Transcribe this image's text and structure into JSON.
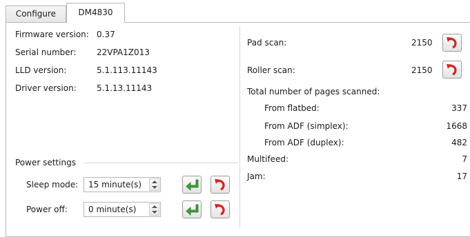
{
  "tabs": [
    {
      "label": "Configure"
    },
    {
      "label": "DM4830"
    }
  ],
  "info": {
    "firmware_label": "Firmware version:",
    "firmware_value": "0.37",
    "serial_label": "Serial number:",
    "serial_value": "22VPA1Z013",
    "lld_label": "LLD version:",
    "lld_value": "5.1.113.11143",
    "driver_label": "Driver version:",
    "driver_value": "5.1.13.11143"
  },
  "power": {
    "group_label": "Power settings",
    "sleep_label": "Sleep mode:",
    "sleep_value": "15 minute(s)",
    "off_label": "Power off:",
    "off_value": "0 minute(s)"
  },
  "counters": {
    "pad_label": "Pad scan:",
    "pad_value": "2150",
    "roller_label": "Roller scan:",
    "roller_value": "2150",
    "total_label": "Total number of pages scanned:",
    "flatbed_label": "From flatbed:",
    "flatbed_value": "337",
    "adf_simplex_label": "From ADF (simplex):",
    "adf_simplex_value": "1668",
    "adf_duplex_label": "From ADF (duplex):",
    "adf_duplex_value": "482",
    "multifeed_label": "Multifeed:",
    "multifeed_value": "7",
    "jam_label": "Jam:",
    "jam_value": "17"
  },
  "icons": {
    "apply": "apply-enter-icon",
    "reset": "reset-undo-icon",
    "apply_color": "#3aa335",
    "reset_color": "#d8231f"
  }
}
